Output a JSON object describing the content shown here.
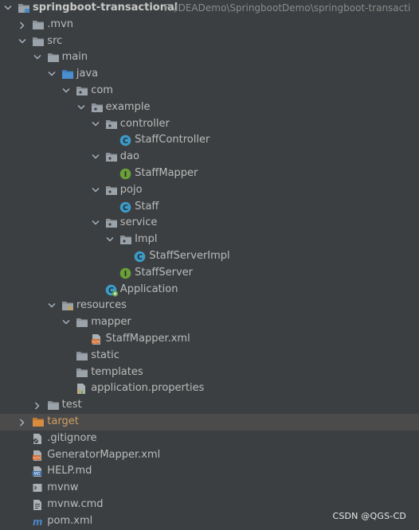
{
  "project": {
    "name": "springboot-transactional",
    "path": "F:\\IDEADemo\\SpringbootDemo\\springboot-transacti"
  },
  "tree": [
    {
      "label": "springboot-transactional",
      "level": 0,
      "state": "open",
      "icon": "module-folder-icon",
      "bold": true
    },
    {
      "label": ".mvn",
      "level": 1,
      "state": "closed",
      "icon": "folder-icon"
    },
    {
      "label": "src",
      "level": 1,
      "state": "open",
      "icon": "folder-icon"
    },
    {
      "label": "main",
      "level": 2,
      "state": "open",
      "icon": "folder-icon"
    },
    {
      "label": "java",
      "level": 3,
      "state": "open",
      "icon": "source-folder-icon"
    },
    {
      "label": "com",
      "level": 4,
      "state": "open",
      "icon": "package-icon"
    },
    {
      "label": "example",
      "level": 5,
      "state": "open",
      "icon": "package-icon"
    },
    {
      "label": "controller",
      "level": 6,
      "state": "open",
      "icon": "package-icon"
    },
    {
      "label": "StaffController",
      "level": 7,
      "state": "leaf",
      "icon": "class-icon"
    },
    {
      "label": "dao",
      "level": 6,
      "state": "open",
      "icon": "package-icon"
    },
    {
      "label": "StaffMapper",
      "level": 7,
      "state": "leaf",
      "icon": "interface-icon"
    },
    {
      "label": "pojo",
      "level": 6,
      "state": "open",
      "icon": "package-icon"
    },
    {
      "label": "Staff",
      "level": 7,
      "state": "leaf",
      "icon": "class-icon"
    },
    {
      "label": "service",
      "level": 6,
      "state": "open",
      "icon": "package-icon"
    },
    {
      "label": "Impl",
      "level": 7,
      "state": "open",
      "icon": "package-icon"
    },
    {
      "label": "StaffServerImpl",
      "level": 8,
      "state": "leaf",
      "icon": "class-icon"
    },
    {
      "label": "StaffServer",
      "level": 7,
      "state": "leaf",
      "icon": "interface-icon"
    },
    {
      "label": "Application",
      "level": 6,
      "state": "leaf",
      "icon": "spring-boot-class-icon"
    },
    {
      "label": "resources",
      "level": 3,
      "state": "open",
      "icon": "resources-folder-icon"
    },
    {
      "label": "mapper",
      "level": 4,
      "state": "open",
      "icon": "folder-icon"
    },
    {
      "label": "StaffMapper.xml",
      "level": 5,
      "state": "leaf",
      "icon": "xml-file-icon"
    },
    {
      "label": "static",
      "level": 4,
      "state": "leaf",
      "icon": "folder-icon"
    },
    {
      "label": "templates",
      "level": 4,
      "state": "leaf",
      "icon": "folder-icon"
    },
    {
      "label": "application.properties",
      "level": 4,
      "state": "leaf",
      "icon": "properties-file-icon"
    },
    {
      "label": "test",
      "level": 2,
      "state": "closed",
      "icon": "folder-icon"
    },
    {
      "label": "target",
      "level": 1,
      "state": "closed",
      "icon": "excluded-folder-icon",
      "orange": true,
      "selected": true
    },
    {
      "label": ".gitignore",
      "level": 1,
      "state": "leaf",
      "icon": "gitignore-file-icon"
    },
    {
      "label": "GeneratorMapper.xml",
      "level": 1,
      "state": "leaf",
      "icon": "xml-file-icon"
    },
    {
      "label": "HELP.md",
      "level": 1,
      "state": "leaf",
      "icon": "markdown-file-icon"
    },
    {
      "label": "mvnw",
      "level": 1,
      "state": "leaf",
      "icon": "script-file-icon"
    },
    {
      "label": "mvnw.cmd",
      "level": 1,
      "state": "leaf",
      "icon": "text-file-icon"
    },
    {
      "label": "pom.xml",
      "level": 1,
      "state": "leaf",
      "icon": "maven-file-icon"
    }
  ],
  "watermark": "CSDN @QGS-CD",
  "colors": {
    "background": "#3c3f41",
    "selected_row": "#4b4b4b",
    "text": "#bbbbbb",
    "excluded_folder": "#d98c3f",
    "class_icon": "#3d9bc7",
    "interface_icon": "#6a9f3a"
  }
}
